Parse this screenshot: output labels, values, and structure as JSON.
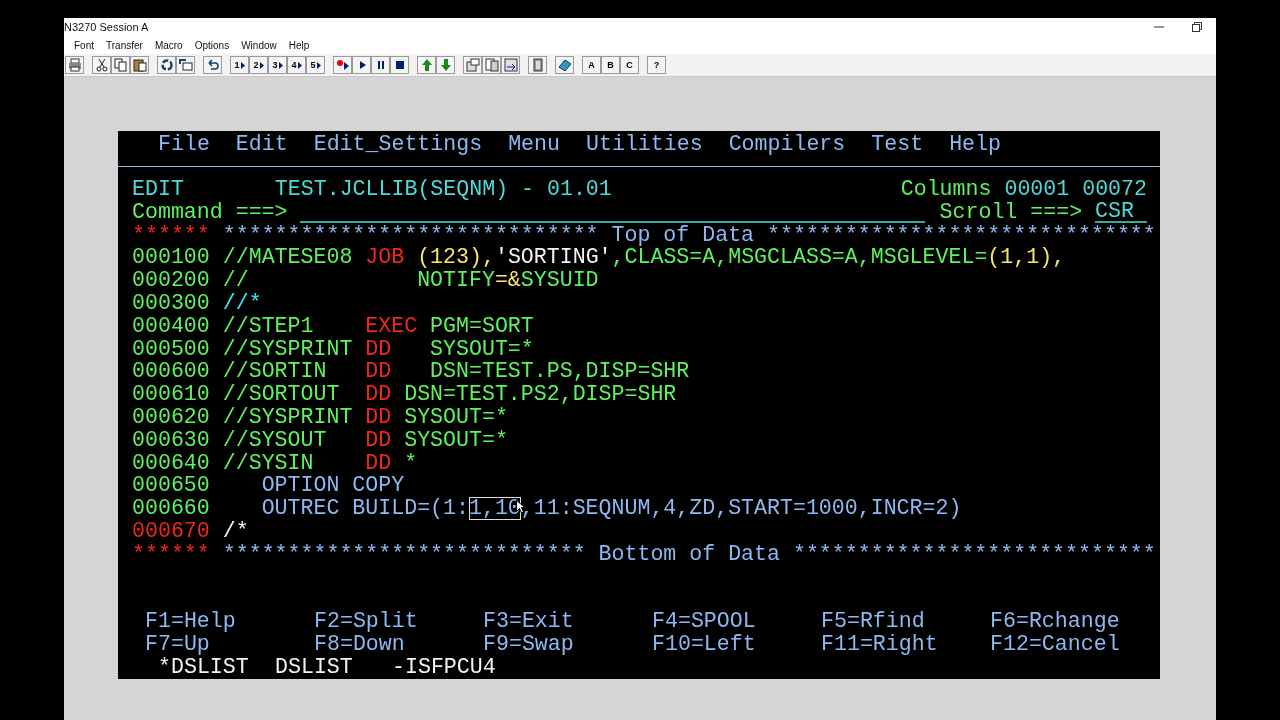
{
  "window": {
    "title": "N3270 Session A"
  },
  "menu": [
    "Font",
    "Transfer",
    "Macro",
    "Options",
    "Window",
    "Help"
  ],
  "toolbar": [
    {
      "kind": "print"
    },
    {
      "kind": "gap"
    },
    {
      "kind": "cut"
    },
    {
      "kind": "copy"
    },
    {
      "kind": "paste"
    },
    {
      "kind": "gap"
    },
    {
      "kind": "refresh"
    },
    {
      "kind": "swap"
    },
    {
      "kind": "gap"
    },
    {
      "kind": "undo"
    },
    {
      "kind": "gap"
    },
    {
      "kind": "macro",
      "label": "1"
    },
    {
      "kind": "macro",
      "label": "2"
    },
    {
      "kind": "macro",
      "label": "3"
    },
    {
      "kind": "macro",
      "label": "4"
    },
    {
      "kind": "macro",
      "label": "5"
    },
    {
      "kind": "gap"
    },
    {
      "kind": "record"
    },
    {
      "kind": "play"
    },
    {
      "kind": "pause"
    },
    {
      "kind": "stop"
    },
    {
      "kind": "gap"
    },
    {
      "kind": "up"
    },
    {
      "kind": "down"
    },
    {
      "kind": "gap"
    },
    {
      "kind": "send"
    },
    {
      "kind": "receive"
    },
    {
      "kind": "transfer"
    },
    {
      "kind": "gap"
    },
    {
      "kind": "exit"
    },
    {
      "kind": "gap"
    },
    {
      "kind": "notes"
    },
    {
      "kind": "gap"
    },
    {
      "kind": "letter",
      "label": "A"
    },
    {
      "kind": "letter",
      "label": "B"
    },
    {
      "kind": "letter",
      "label": "C"
    },
    {
      "kind": "gap"
    },
    {
      "kind": "letter",
      "label": "?"
    }
  ],
  "terminal": {
    "menu": [
      "File",
      "Edit",
      "Edit_Settings",
      "Menu",
      "Utilities",
      "Compilers",
      "Test",
      "Help"
    ],
    "header": {
      "mode": "EDIT",
      "dataset": "TEST.JCLLIB(SEQNM) - 01.01",
      "columns_label": "Columns",
      "columns": "00001 00072"
    },
    "command": {
      "label": "Command ===>",
      "scroll_label": "Scroll ===>",
      "scroll": "CSR"
    },
    "lines": [
      {
        "number": {
          "text": "******",
          "color": "#f0261e"
        },
        "segments": [
          {
            "text": "***************************** Top of Data ******************************",
            "color": "#8db8f0"
          }
        ]
      },
      {
        "number": {
          "text": "000100",
          "color": "#5ef25e"
        },
        "segments": [
          {
            "text": "//MATESE08 ",
            "color": "#5ef25e"
          },
          {
            "text": "JOB ",
            "color": "#f0261e"
          },
          {
            "text": "(123),",
            "color": "#f6e66a"
          },
          {
            "text": "'SORTING'",
            "color": "#f4f4f4"
          },
          {
            "text": ",CLASS=A,MSGCLASS=A,MSGLEVEL=",
            "color": "#5ef25e"
          },
          {
            "text": "(1,1),",
            "color": "#f6e66a"
          }
        ]
      },
      {
        "number": {
          "text": "000200",
          "color": "#5ef25e"
        },
        "segments": [
          {
            "text": "//             NOTIFY",
            "color": "#5ef25e"
          },
          {
            "text": "=&",
            "color": "#f6e66a"
          },
          {
            "text": "SYSUID",
            "color": "#5ef25e"
          }
        ]
      },
      {
        "number": {
          "text": "000300",
          "color": "#5ef25e"
        },
        "segments": [
          {
            "text": "//*",
            "color": "#3ce6f0"
          }
        ]
      },
      {
        "number": {
          "text": "000400",
          "color": "#5ef25e"
        },
        "segments": [
          {
            "text": "//STEP1    ",
            "color": "#5ef25e"
          },
          {
            "text": "EXEC",
            "color": "#f0261e"
          },
          {
            "text": " PGM=SORT",
            "color": "#5ef25e"
          }
        ]
      },
      {
        "number": {
          "text": "000500",
          "color": "#5ef25e"
        },
        "segments": [
          {
            "text": "//SYSPRINT ",
            "color": "#5ef25e"
          },
          {
            "text": "DD",
            "color": "#f0261e"
          },
          {
            "text": "   SYSOUT=*",
            "color": "#5ef25e"
          }
        ]
      },
      {
        "number": {
          "text": "000600",
          "color": "#5ef25e"
        },
        "segments": [
          {
            "text": "//SORTIN   ",
            "color": "#5ef25e"
          },
          {
            "text": "DD",
            "color": "#f0261e"
          },
          {
            "text": "   DSN=TEST.PS,DISP=SHR",
            "color": "#5ef25e"
          }
        ]
      },
      {
        "number": {
          "text": "000610",
          "color": "#5ef25e"
        },
        "segments": [
          {
            "text": "//SORTOUT  ",
            "color": "#5ef25e"
          },
          {
            "text": "DD",
            "color": "#f0261e"
          },
          {
            "text": " DSN=TEST.PS2,DISP=SHR",
            "color": "#5ef25e"
          }
        ]
      },
      {
        "number": {
          "text": "000620",
          "color": "#5ef25e"
        },
        "segments": [
          {
            "text": "//SYSPRINT ",
            "color": "#5ef25e"
          },
          {
            "text": "DD",
            "color": "#f0261e"
          },
          {
            "text": " SYSOUT=*",
            "color": "#5ef25e"
          }
        ]
      },
      {
        "number": {
          "text": "000630",
          "color": "#5ef25e"
        },
        "segments": [
          {
            "text": "//SYSOUT   ",
            "color": "#5ef25e"
          },
          {
            "text": "DD",
            "color": "#f0261e"
          },
          {
            "text": " SYSOUT=*",
            "color": "#5ef25e"
          }
        ]
      },
      {
        "number": {
          "text": "000640",
          "color": "#5ef25e"
        },
        "segments": [
          {
            "text": "//SYSIN    ",
            "color": "#5ef25e"
          },
          {
            "text": "DD",
            "color": "#f0261e"
          },
          {
            "text": " *",
            "color": "#5ef25e"
          }
        ]
      },
      {
        "number": {
          "text": "000650",
          "color": "#5ef25e"
        },
        "segments": [
          {
            "text": "   OPTION COPY",
            "color": "#8db8f0"
          }
        ]
      },
      {
        "number": {
          "text": "000660",
          "color": "#5ef25e"
        },
        "segments": [
          {
            "text": "   OUTREC BUILD=(1:",
            "color": "#8db8f0"
          },
          {
            "text": "1,10",
            "color": "#8db8f0",
            "boxed": true
          },
          {
            "text": ",11:SEQNUM,4,ZD,START=1000,INCR=2)",
            "color": "#8db8f0"
          }
        ]
      },
      {
        "number": {
          "text": "000670",
          "color": "#f0261e"
        },
        "segments": [
          {
            "text": "/*",
            "color": "#f4f4f4"
          }
        ]
      },
      {
        "number": {
          "text": "******",
          "color": "#f0261e"
        },
        "segments": [
          {
            "text": "**************************** Bottom of Data ****************************",
            "color": "#8db8f0"
          }
        ]
      }
    ],
    "function_keys": [
      [
        "F1=Help",
        "F2=Split",
        "F3=Exit",
        "F4=SPOOL",
        "F5=Rfind",
        "F6=Rchange"
      ],
      [
        "F7=Up",
        "F8=Down",
        "F9=Swap",
        "F10=Left",
        "F11=Right",
        "F12=Cancel"
      ]
    ],
    "sessions": [
      "*DSLIST",
      "DSLIST",
      "-ISFPCU4"
    ]
  }
}
